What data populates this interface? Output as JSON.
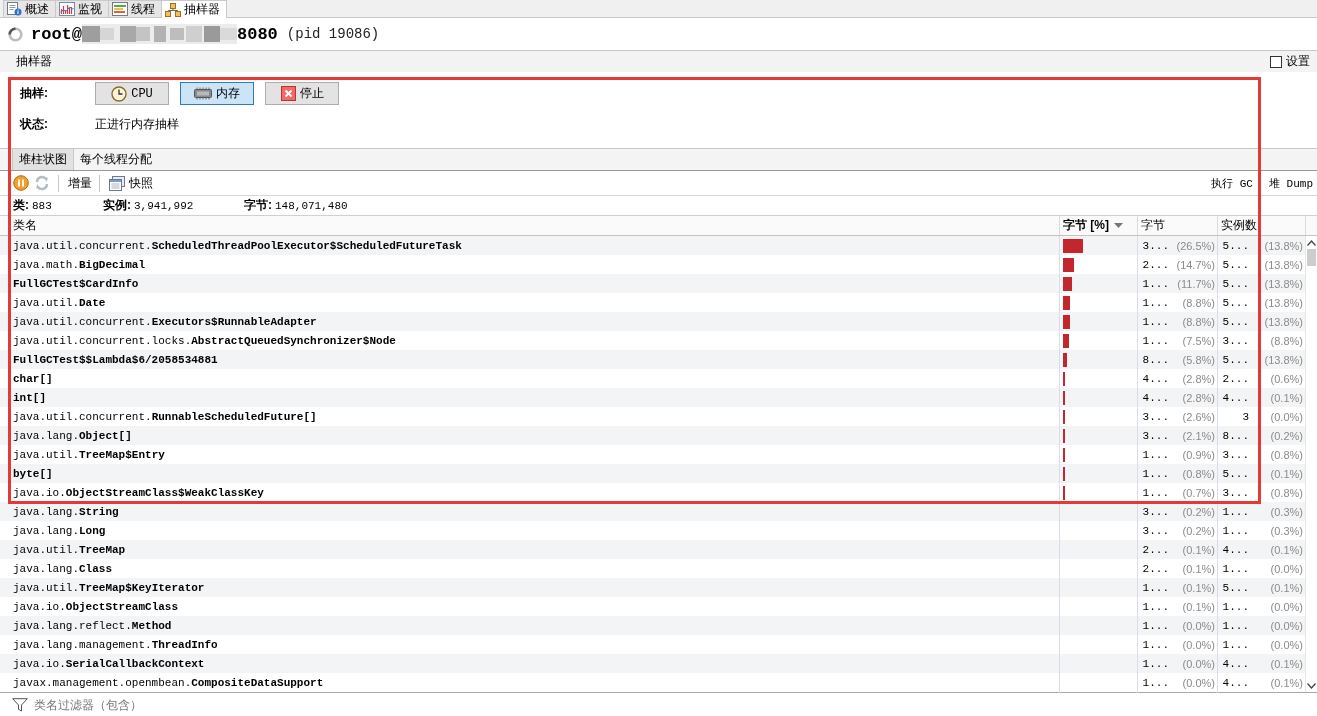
{
  "tabs": [
    {
      "label": "概述",
      "kind": "overview",
      "selected": false
    },
    {
      "label": "监视",
      "kind": "monitor",
      "selected": false
    },
    {
      "label": "线程",
      "kind": "threads",
      "selected": false
    },
    {
      "label": "抽样器",
      "kind": "sampler",
      "selected": true
    }
  ],
  "title": {
    "user": "root@",
    "port": "8080",
    "pid": "(pid 19086)"
  },
  "panel": {
    "title": "抽样器",
    "settings": {
      "label": "设置",
      "checked": false
    }
  },
  "sampling": {
    "label": "抽样:",
    "buttons": [
      {
        "label": "CPU",
        "kind": "cpu",
        "selected": false
      },
      {
        "label": "内存",
        "kind": "memory",
        "selected": true
      },
      {
        "label": "停止",
        "kind": "stop",
        "selected": false
      }
    ]
  },
  "status": {
    "label": "状态:",
    "value": "正进行内存抽样"
  },
  "views": [
    {
      "label": "堆柱状图",
      "selected": true
    },
    {
      "label": "每个线程分配",
      "selected": false
    }
  ],
  "toolbar": {
    "controls": [
      {
        "kind": "pause",
        "disabled": false
      },
      {
        "kind": "refresh",
        "disabled": true
      }
    ],
    "buttons": [
      {
        "kind": "delta",
        "label": "增量"
      },
      {
        "kind": "snapshot",
        "label": "快照"
      }
    ],
    "actions": [
      {
        "label": "执行 GC"
      },
      {
        "label": "堆 Dump"
      }
    ]
  },
  "summary": [
    {
      "label": "类:",
      "value": "883"
    },
    {
      "label": "实例:",
      "value": "3,941,992"
    },
    {
      "label": "字节:",
      "value": "148,071,480"
    }
  ],
  "table": {
    "columns": [
      {
        "label": "类名",
        "sorted": false
      },
      {
        "label": "字节 [%]",
        "sorted": true
      },
      {
        "label": "字节",
        "sorted": false
      },
      {
        "label": "实例数",
        "sorted": false
      }
    ],
    "rows": [
      {
        "name": "java.util.concurrent.**ScheduledThreadPoolExecutor$ScheduledFutureTask**",
        "level": 0.265,
        "bytes": "3...",
        "bytes_percent": "(26.5%)",
        "instances": "5...",
        "instances_percent": "(13.8%)"
      },
      {
        "name": "java.math.**BigDecimal**",
        "level": 0.147,
        "bytes": "2...",
        "bytes_percent": "(14.7%)",
        "instances": "5...",
        "instances_percent": "(13.8%)"
      },
      {
        "name": "**FullGCTest$CardInfo**",
        "level": 0.117,
        "bytes": "1...",
        "bytes_percent": "(11.7%)",
        "instances": "5...",
        "instances_percent": "(13.8%)"
      },
      {
        "name": "java.util.**Date**",
        "level": 0.088,
        "bytes": "1...",
        "bytes_percent": "(8.8%)",
        "instances": "5...",
        "instances_percent": "(13.8%)"
      },
      {
        "name": "java.util.concurrent.**Executors$RunnableAdapter**",
        "level": 0.088,
        "bytes": "1...",
        "bytes_percent": "(8.8%)",
        "instances": "5...",
        "instances_percent": "(13.8%)"
      },
      {
        "name": "java.util.concurrent.locks.**AbstractQueuedSynchronizer$Node**",
        "level": 0.075,
        "bytes": "1...",
        "bytes_percent": "(7.5%)",
        "instances": "3...",
        "instances_percent": "(8.8%)"
      },
      {
        "name": "**FullGCTest$$Lambda$6/2058534881**",
        "level": 0.058,
        "bytes": "8...",
        "bytes_percent": "(5.8%)",
        "instances": "5...",
        "instances_percent": "(13.8%)"
      },
      {
        "name": "**char[]**",
        "level": 0.028,
        "bytes": "4...",
        "bytes_percent": "(2.8%)",
        "instances": "2...",
        "instances_percent": "(0.6%)"
      },
      {
        "name": "**int[]**",
        "level": 0.028,
        "bytes": "4...",
        "bytes_percent": "(2.8%)",
        "instances": "4...",
        "instances_percent": "(0.1%)"
      },
      {
        "name": "java.util.concurrent.**RunnableScheduledFuture[]**",
        "level": 0.026,
        "bytes": "3...",
        "bytes_percent": "(2.6%)",
        "instances": "3",
        "instances_percent": "(0.0%)"
      },
      {
        "name": "java.lang.**Object[]**",
        "level": 0.021,
        "bytes": "3...",
        "bytes_percent": "(2.1%)",
        "instances": "8...",
        "instances_percent": "(0.2%)"
      },
      {
        "name": "java.util.**TreeMap$Entry**",
        "level": 0.009,
        "bytes": "1...",
        "bytes_percent": "(0.9%)",
        "instances": "3...",
        "instances_percent": "(0.8%)"
      },
      {
        "name": "**byte[]**",
        "level": 0.008,
        "bytes": "1...",
        "bytes_percent": "(0.8%)",
        "instances": "5...",
        "instances_percent": "(0.1%)"
      },
      {
        "name": "java.io.**ObjectStreamClass$WeakClassKey**",
        "level": 0.007,
        "bytes": "1...",
        "bytes_percent": "(0.7%)",
        "instances": "3...",
        "instances_percent": "(0.8%)"
      },
      {
        "name": "java.lang.**String**",
        "bytes": "3...",
        "bytes_percent": "(0.2%)",
        "instances": "1...",
        "instances_percent": "(0.3%)"
      },
      {
        "name": "java.lang.**Long**",
        "bytes": "3...",
        "bytes_percent": "(0.2%)",
        "instances": "1...",
        "instances_percent": "(0.3%)"
      },
      {
        "name": "java.util.**TreeMap**",
        "bytes": "2...",
        "bytes_percent": "(0.1%)",
        "instances": "4...",
        "instances_percent": "(0.1%)"
      },
      {
        "name": "java.lang.**Class**",
        "bytes": "2...",
        "bytes_percent": "(0.1%)",
        "instances": "1...",
        "instances_percent": "(0.0%)"
      },
      {
        "name": "java.util.**TreeMap$KeyIterator**",
        "bytes": "1...",
        "bytes_percent": "(0.1%)",
        "instances": "5...",
        "instances_percent": "(0.1%)"
      },
      {
        "name": "java.io.**ObjectStreamClass**",
        "bytes": "1...",
        "bytes_percent": "(0.1%)",
        "instances": "1...",
        "instances_percent": "(0.0%)"
      },
      {
        "name": "java.lang.reflect.**Method**",
        "bytes": "1...",
        "bytes_percent": "(0.0%)",
        "instances": "1...",
        "instances_percent": "(0.0%)"
      },
      {
        "name": "java.lang.management.**ThreadInfo**",
        "bytes": "1...",
        "bytes_percent": "(0.0%)",
        "instances": "1...",
        "instances_percent": "(0.0%)"
      },
      {
        "name": "java.io.**SerialCallbackContext**",
        "bytes": "1...",
        "bytes_percent": "(0.0%)",
        "instances": "4...",
        "instances_percent": "(0.1%)"
      },
      {
        "name": "javax.management.openmbean.**CompositeDataSupport**",
        "bytes": "1...",
        "bytes_percent": "(0.0%)",
        "instances": "4...",
        "instances_percent": "(0.1%)"
      }
    ]
  },
  "filter": {
    "placeholder": "类名过滤器（包含）"
  }
}
